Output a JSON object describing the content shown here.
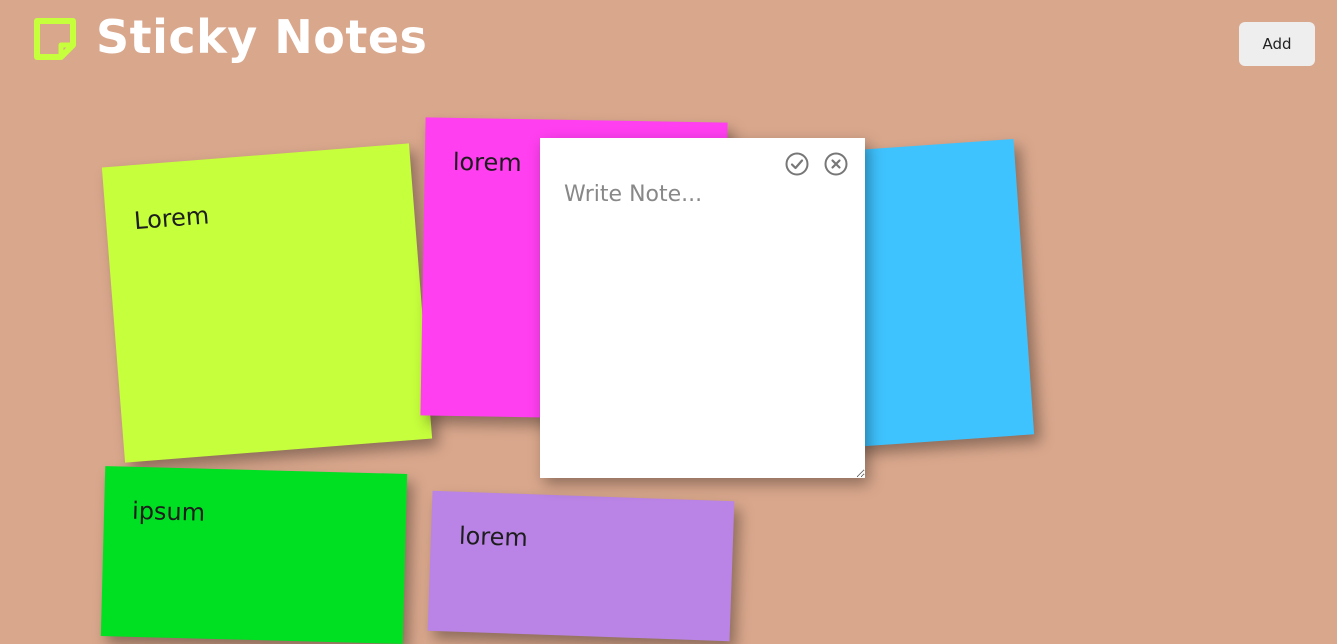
{
  "header": {
    "title": "Sticky Notes",
    "add_button_label": "Add",
    "logo_icon": "sticky-note-icon",
    "logo_color": "#c6ff3c"
  },
  "notes": [
    {
      "text": "Lorem",
      "color": "#c6ff3c"
    },
    {
      "text": "lorem",
      "color": "#ff3ff0"
    },
    {
      "text": "",
      "color": "#3fc3ff"
    },
    {
      "text": "ipsum",
      "color": "#00e022"
    },
    {
      "text": "lorem",
      "color": "#b984e5"
    }
  ],
  "editor": {
    "placeholder": "Write Note...",
    "value": "",
    "confirm_icon": "check-circle-icon",
    "cancel_icon": "close-circle-icon"
  },
  "colors": {
    "background": "#d9a78c",
    "title": "#ffffff",
    "button_bg": "#eeeeee"
  }
}
